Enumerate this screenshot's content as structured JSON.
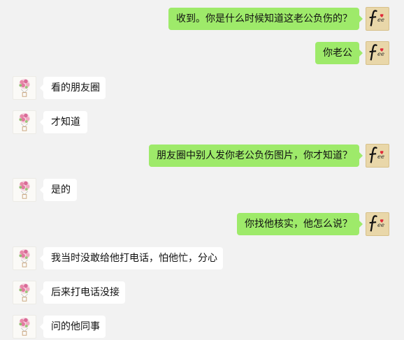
{
  "chat": {
    "messages": [
      {
        "side": "right",
        "text": "收到。你是什么时候知道这老公负伤的？"
      },
      {
        "side": "right",
        "text": "你老公"
      },
      {
        "side": "left",
        "text": "看的朋友圈"
      },
      {
        "side": "left",
        "text": "才知道"
      },
      {
        "side": "right",
        "text": "朋友圈中别人发你老公负伤图片，你才知道？"
      },
      {
        "side": "left",
        "text": "是的"
      },
      {
        "side": "right",
        "text": "你找他核实，他怎么说？"
      },
      {
        "side": "left",
        "text": "我当时没敢给他打电话，怕他忙，分心"
      },
      {
        "side": "left",
        "text": "后来打电话没接"
      },
      {
        "side": "left",
        "text": "问的他同事"
      }
    ]
  },
  "avatars": {
    "self": {
      "icon": "fee-logo-icon",
      "logo_text": "fee",
      "bg": "#e9d7a9"
    },
    "contact": {
      "icon": "flower-balloon-icon",
      "bg": "#fbfaf7"
    }
  },
  "colors": {
    "background": "#f2f2f2",
    "bubble_self": "#9eea6a",
    "bubble_other": "#ffffff"
  }
}
